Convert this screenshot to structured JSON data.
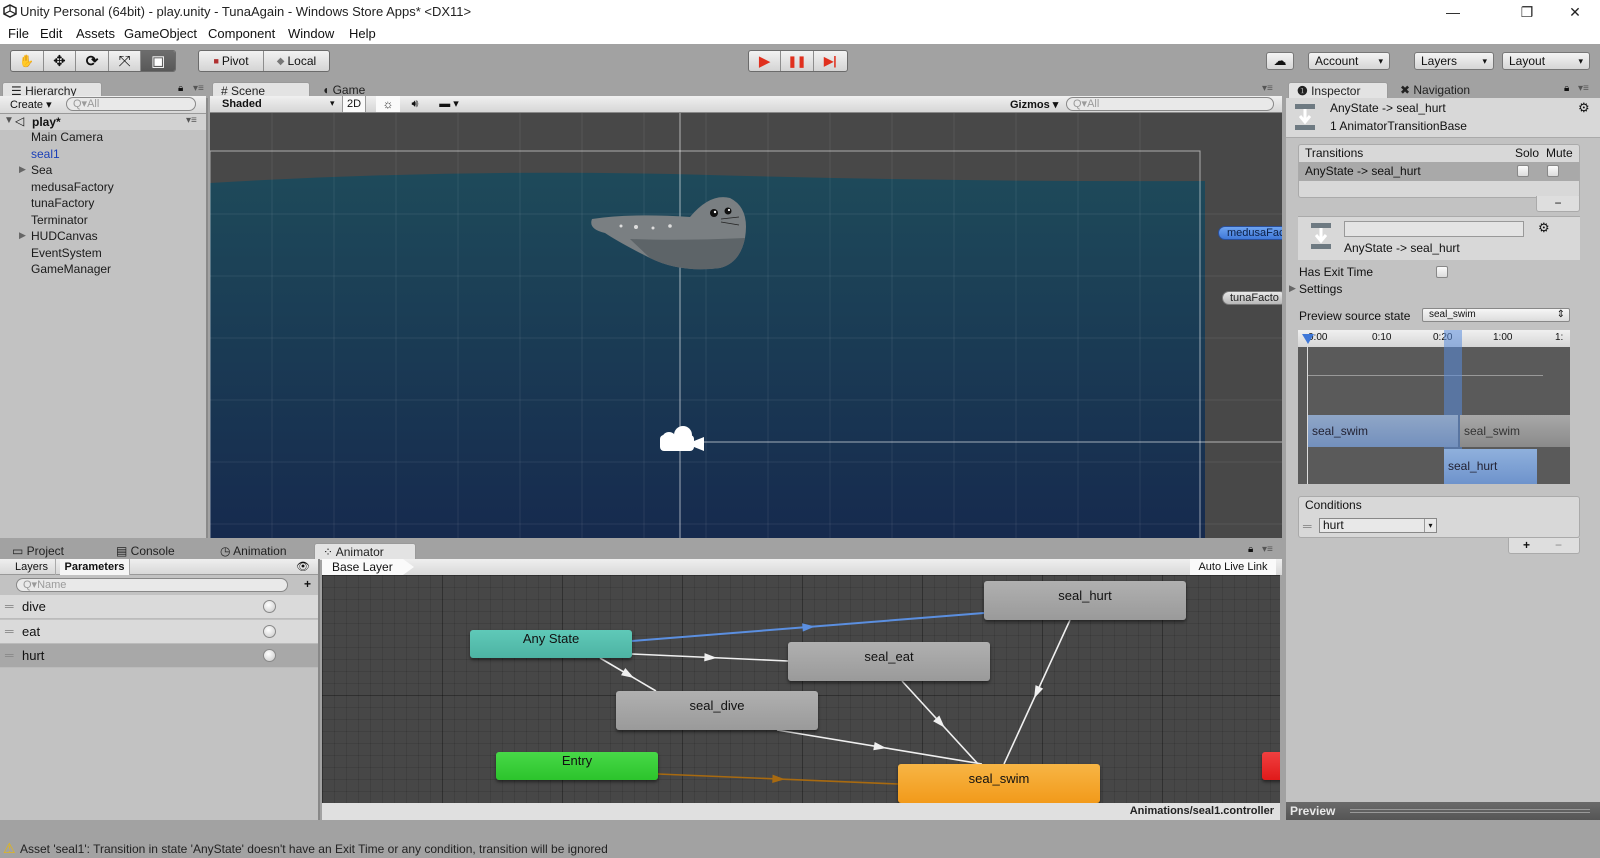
{
  "window": {
    "title": "Unity Personal (64bit) - play.unity - TunaAgain - Windows Store Apps* <DX11>",
    "minimize": "—",
    "maximize": "❐",
    "close": "✕"
  },
  "menu": [
    "File",
    "Edit",
    "Assets",
    "GameObject",
    "Component",
    "Window",
    "Help"
  ],
  "toolbar": {
    "tools": [
      "hand-icon",
      "move-icon",
      "rotate-icon",
      "scale-icon",
      "rect-icon"
    ],
    "tool_glyphs": [
      "✋",
      "✥",
      "⟳",
      "⤧",
      "▣"
    ],
    "pivot_label": "Pivot",
    "local_label": "Local",
    "play_glyph": "▶",
    "pause_glyph": "❚❚",
    "step_glyph": "▶|",
    "cloud_glyph": "☁",
    "account_label": "Account",
    "layers_label": "Layers",
    "layout_label": "Layout",
    "accent_red": "#e0301e"
  },
  "hierarchy": {
    "tab_label": "Hierarchy",
    "create_label": "Create",
    "search_placeholder": "Q▾All",
    "scene_name": "play*",
    "items": [
      {
        "label": "Main Camera",
        "expandable": false,
        "selected": false
      },
      {
        "label": "seal1",
        "expandable": false,
        "selected": true
      },
      {
        "label": "Sea",
        "expandable": true,
        "selected": false
      },
      {
        "label": "medusaFactory",
        "expandable": false,
        "selected": false
      },
      {
        "label": "tunaFactory",
        "expandable": false,
        "selected": false
      },
      {
        "label": "Terminator",
        "expandable": false,
        "selected": false
      },
      {
        "label": "HUDCanvas",
        "expandable": true,
        "selected": false
      },
      {
        "label": "EventSystem",
        "expandable": false,
        "selected": false
      },
      {
        "label": "GameManager",
        "expandable": false,
        "selected": false
      }
    ]
  },
  "scene": {
    "tabs": [
      "Scene",
      "Game"
    ],
    "shading_mode": "Shaded",
    "mode_2d": "2D",
    "gizmos_label": "Gizmos",
    "search_placeholder": "Q▾All",
    "labels": {
      "medusa": "medusaFac",
      "tuna": "tunaFacto"
    }
  },
  "inspector": {
    "tabs": [
      "Inspector",
      "Navigation"
    ],
    "header_title": "AnyState -> seal_hurt",
    "header_subtitle": "1 AnimatorTransitionBase",
    "transitions_header": "Transitions",
    "solo_label": "Solo",
    "mute_label": "Mute",
    "transition_row": "AnyState -> seal_hurt",
    "remove_label": "−",
    "transition_name_value": "",
    "transition_label": "AnyState -> seal_hurt",
    "has_exit_time_label": "Has Exit Time",
    "has_exit_time": false,
    "settings_label": "Settings",
    "preview_source_label": "Preview source state",
    "preview_source_value": "seal_swim",
    "timeline_ticks": [
      "0:00",
      "0:10",
      "0:20",
      "1:00",
      "1:"
    ],
    "timeline_clips": [
      "seal_swim",
      "seal_swim",
      "seal_hurt"
    ],
    "conditions_header": "Conditions",
    "condition_value": "hurt",
    "add_label": "+",
    "minus_label": "−",
    "preview_label": "Preview"
  },
  "bottom": {
    "tabs": [
      "Project",
      "Console",
      "Animation",
      "Animator"
    ],
    "subtabs": [
      "Layers",
      "Parameters"
    ],
    "search_placeholder": "Q▾Name",
    "add_label": "+",
    "parameters": [
      {
        "name": "dive",
        "selected": false
      },
      {
        "name": "eat",
        "selected": false
      },
      {
        "name": "hurt",
        "selected": true
      }
    ],
    "breadcrumb": "Base Layer",
    "auto_live_link": "Auto Live Link",
    "controller_path": "Animations/seal1.controller"
  },
  "animator_graph": {
    "nodes": [
      {
        "id": "any",
        "label": "Any State",
        "kind": "any"
      },
      {
        "id": "hurt",
        "label": "seal_hurt",
        "kind": "state"
      },
      {
        "id": "eat",
        "label": "seal_eat",
        "kind": "state"
      },
      {
        "id": "dive",
        "label": "seal_dive",
        "kind": "state"
      },
      {
        "id": "entry",
        "label": "Entry",
        "kind": "entry"
      },
      {
        "id": "swim",
        "label": "seal_swim",
        "kind": "default"
      }
    ],
    "transitions": [
      {
        "from": "any",
        "to": "hurt",
        "selected": true
      },
      {
        "from": "any",
        "to": "eat",
        "selected": false
      },
      {
        "from": "any",
        "to": "dive",
        "selected": false
      },
      {
        "from": "dive",
        "to": "swim",
        "selected": false
      },
      {
        "from": "eat",
        "to": "swim",
        "selected": false
      },
      {
        "from": "hurt",
        "to": "swim",
        "selected": false
      },
      {
        "from": "entry",
        "to": "swim",
        "selected": false,
        "default": true
      }
    ],
    "colors": {
      "any": "#5fc9b8",
      "state": "#9a9a9a",
      "entry": "#2cc42c",
      "default": "#f29a1a",
      "exit": "#e01a1a",
      "selected_transition": "#5b8fe0",
      "transition": "#f0f0f0",
      "default_transition": "#a86a10"
    }
  },
  "status": {
    "message": "Asset 'seal1': Transition in state 'AnyState' doesn't have an Exit Time or any condition, transition will be ignored"
  }
}
